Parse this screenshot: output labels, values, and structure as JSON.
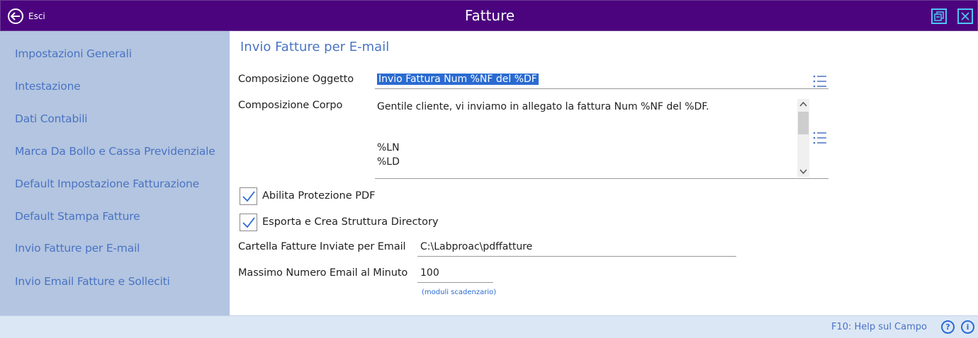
{
  "window": {
    "title": "Fatture",
    "back_label": "Esci"
  },
  "sidebar": {
    "items": [
      {
        "label": "Impostazioni Generali"
      },
      {
        "label": "Intestazione"
      },
      {
        "label": "Dati Contabili"
      },
      {
        "label": "Marca Da Bollo e Cassa Previdenziale"
      },
      {
        "label": "Default Impostazione Fatturazione"
      },
      {
        "label": "Default Stampa Fatture"
      },
      {
        "label": "Invio Fatture per E-mail"
      },
      {
        "label": "Invio Email Fatture e Solleciti"
      }
    ]
  },
  "main": {
    "section_title": "Invio Fatture per E-mail",
    "subject": {
      "label": "Composizione Oggetto",
      "value": "Invio Fattura Num %NF del %DF"
    },
    "body": {
      "label": "Composizione Corpo",
      "lines": [
        "Gentile cliente, vi inviamo in allegato la fattura  Num %NF del %DF.",
        "%LN",
        "%LD"
      ]
    },
    "pdf_protection": {
      "label": "Abilita Protezione PDF",
      "checked": true
    },
    "export_directory": {
      "label": "Esporta e Crea Struttura Directory",
      "checked": true
    },
    "sent_folder": {
      "label": "Cartella Fatture Inviate per Email",
      "value": "C:\\Labproac\\pdffatture"
    },
    "max_emails": {
      "label": "Massimo Numero Email al Minuto",
      "value": "100",
      "hint": "(moduli scadenzario)"
    }
  },
  "statusbar": {
    "help_text": "F10: Help sul Campo",
    "help_icon": "?",
    "info_icon": "i"
  },
  "colors": {
    "titlebar": "#4b047e",
    "sidebar": "#b3c5e0",
    "accent": "#4a73c4",
    "selection": "#2a6bd1"
  }
}
